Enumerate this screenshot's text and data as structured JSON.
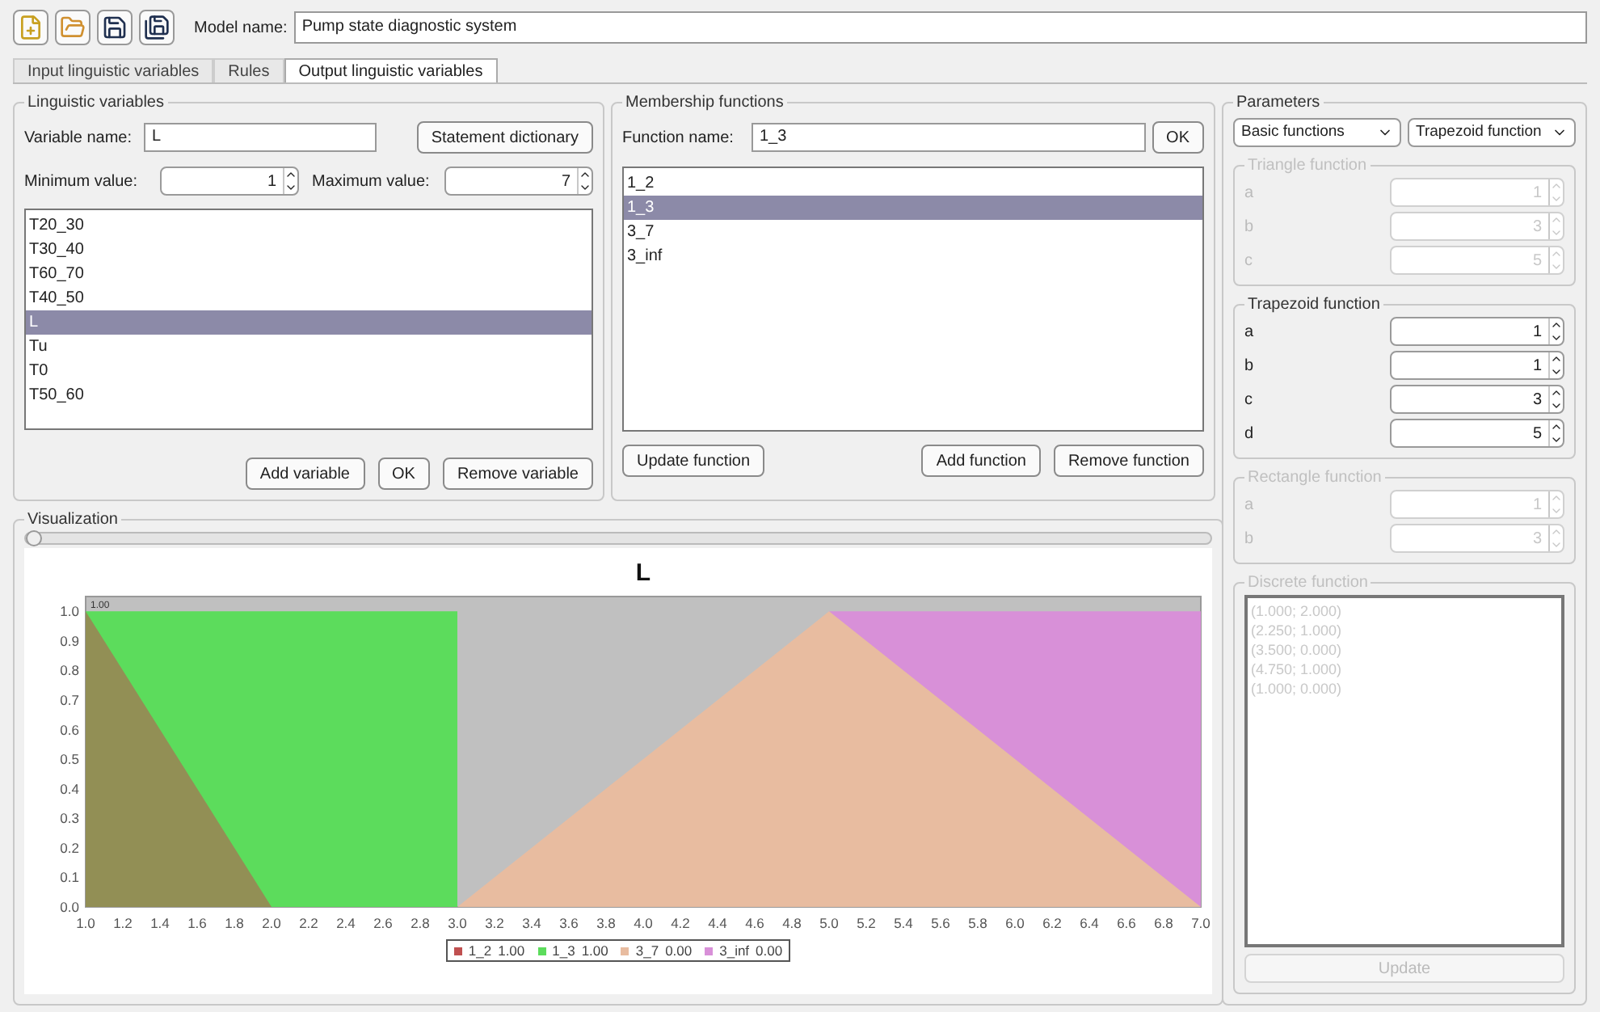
{
  "toolbar": {
    "buttons": [
      {
        "kind": "new"
      },
      {
        "kind": "open"
      },
      {
        "kind": "save"
      },
      {
        "kind": "save_as"
      }
    ],
    "model_label": "Model name:",
    "model_name": "Pump state diagnostic system"
  },
  "tabs": [
    {
      "label": "Input linguistic variables",
      "selected": false
    },
    {
      "label": "Rules",
      "selected": false
    },
    {
      "label": "Output linguistic variables",
      "selected": true
    }
  ],
  "variables": {
    "title": "Linguistic variables",
    "name_label": "Variable name:",
    "name_value": "L",
    "dictionary_button": "Statement dictionary",
    "min_label": "Minimum value:",
    "min_value": "1",
    "max_label": "Maximum value:",
    "max_value": "7",
    "items": [
      {
        "label": "T20_30",
        "selected": false
      },
      {
        "label": "T30_40",
        "selected": false
      },
      {
        "label": "T60_70",
        "selected": false
      },
      {
        "label": "T40_50",
        "selected": false
      },
      {
        "label": "L",
        "selected": true
      },
      {
        "label": "Tu",
        "selected": false
      },
      {
        "label": "T0",
        "selected": false
      },
      {
        "label": "T50_60",
        "selected": false
      }
    ],
    "buttons": [
      "Add variable",
      "OK",
      "Remove variable"
    ]
  },
  "functions": {
    "title": "Membership functions",
    "name_label": "Function name:",
    "name_value": "1_3",
    "ok_button": "OK",
    "items": [
      {
        "label": "1_2",
        "selected": false
      },
      {
        "label": "1_3",
        "selected": true
      },
      {
        "label": "3_7",
        "selected": false
      },
      {
        "label": "3_inf",
        "selected": false
      }
    ],
    "update_button": "Update function",
    "buttons": [
      "Add function",
      "Remove function"
    ]
  },
  "parameters": {
    "title": "Parameters",
    "category": "Basic functions",
    "function_type": "Trapezoid function",
    "groups": [
      {
        "title": "Triangle function",
        "enabled": false,
        "fields": [
          {
            "label": "a",
            "value": "1"
          },
          {
            "label": "b",
            "value": "3"
          },
          {
            "label": "c",
            "value": "5"
          }
        ]
      },
      {
        "title": "Trapezoid function",
        "enabled": true,
        "fields": [
          {
            "label": "a",
            "value": "1"
          },
          {
            "label": "b",
            "value": "1"
          },
          {
            "label": "c",
            "value": "3"
          },
          {
            "label": "d",
            "value": "5"
          }
        ]
      },
      {
        "title": "Rectangle function",
        "enabled": false,
        "fields": [
          {
            "label": "a",
            "value": "1"
          },
          {
            "label": "b",
            "value": "3"
          }
        ]
      }
    ],
    "discrete": {
      "title": "Discrete function",
      "enabled": false,
      "lines": [
        "(1.000; 2.000)",
        "(2.250; 1.000)",
        "(3.500; 0.000)",
        "(4.750; 1.000)",
        "(1.000; 0.000)"
      ]
    },
    "update_button": {
      "label": "Update",
      "disabled": true
    }
  },
  "visualization": {
    "title": "Visualization",
    "slider": {
      "level": 0
    },
    "corner_label": "1.00",
    "legend_values": [
      "1.00",
      "1.00",
      "0.00",
      "0.00"
    ],
    "chart_data": {
      "type": "area",
      "title": "L",
      "x": [
        1,
        2,
        3,
        3,
        5,
        5,
        7
      ],
      "legend": "bottom",
      "series": [
        {
          "name": "3_inf",
          "color": "#d890d8",
          "values": [
            null,
            null,
            null,
            null,
            0,
            1,
            1
          ]
        },
        {
          "name": "3_7",
          "color": "#e8bca0",
          "values": [
            null,
            null,
            null,
            0,
            1,
            1,
            0
          ]
        },
        {
          "name": "1_3",
          "color": "#5cdc5c",
          "values": [
            1,
            1,
            1,
            0,
            null,
            null,
            null
          ]
        },
        {
          "name": "1_2",
          "color": "#c05050",
          "values": [
            1,
            0,
            null,
            null,
            null,
            null,
            null
          ]
        }
      ],
      "xlim": [
        1,
        7
      ],
      "ylim": [
        0,
        1.05
      ],
      "xticks": [
        {
          "value": 1,
          "label": "1.0"
        },
        {
          "value": 1.2,
          "label": "1.2"
        },
        {
          "value": 1.4,
          "label": "1.4"
        },
        {
          "value": 1.6,
          "label": "1.6"
        },
        {
          "value": 1.8,
          "label": "1.8"
        },
        {
          "value": 2,
          "label": "2.0"
        },
        {
          "value": 2.2,
          "label": "2.2"
        },
        {
          "value": 2.4,
          "label": "2.4"
        },
        {
          "value": 2.6,
          "label": "2.6"
        },
        {
          "value": 2.8,
          "label": "2.8"
        },
        {
          "value": 3,
          "label": "3.0"
        },
        {
          "value": 3.2,
          "label": "3.2"
        },
        {
          "value": 3.4,
          "label": "3.4"
        },
        {
          "value": 3.6,
          "label": "3.6"
        },
        {
          "value": 3.8,
          "label": "3.8"
        },
        {
          "value": 4,
          "label": "4.0"
        },
        {
          "value": 4.2,
          "label": "4.2"
        },
        {
          "value": 4.4,
          "label": "4.4"
        },
        {
          "value": 4.6,
          "label": "4.6"
        },
        {
          "value": 4.8,
          "label": "4.8"
        },
        {
          "value": 5,
          "label": "5.0"
        },
        {
          "value": 5.2,
          "label": "5.2"
        },
        {
          "value": 5.4,
          "label": "5.4"
        },
        {
          "value": 5.6,
          "label": "5.6"
        },
        {
          "value": 5.8,
          "label": "5.8"
        },
        {
          "value": 6,
          "label": "6.0"
        },
        {
          "value": 6.2,
          "label": "6.2"
        },
        {
          "value": 6.4,
          "label": "6.4"
        },
        {
          "value": 6.6,
          "label": "6.6"
        },
        {
          "value": 6.8,
          "label": "6.8"
        },
        {
          "value": 7,
          "label": "7.0"
        }
      ],
      "yticks": [
        {
          "value": 0,
          "label": "0.0"
        },
        {
          "value": 0.1,
          "label": "0.1"
        },
        {
          "value": 0.2,
          "label": "0.2"
        },
        {
          "value": 0.3,
          "label": "0.3"
        },
        {
          "value": 0.4,
          "label": "0.4"
        },
        {
          "value": 0.5,
          "label": "0.5"
        },
        {
          "value": 0.6,
          "label": "0.6"
        },
        {
          "value": 0.7,
          "label": "0.7"
        },
        {
          "value": 0.8,
          "label": "0.8"
        },
        {
          "value": 0.9,
          "label": "0.9"
        },
        {
          "value": 1,
          "label": "1.0"
        }
      ]
    }
  }
}
